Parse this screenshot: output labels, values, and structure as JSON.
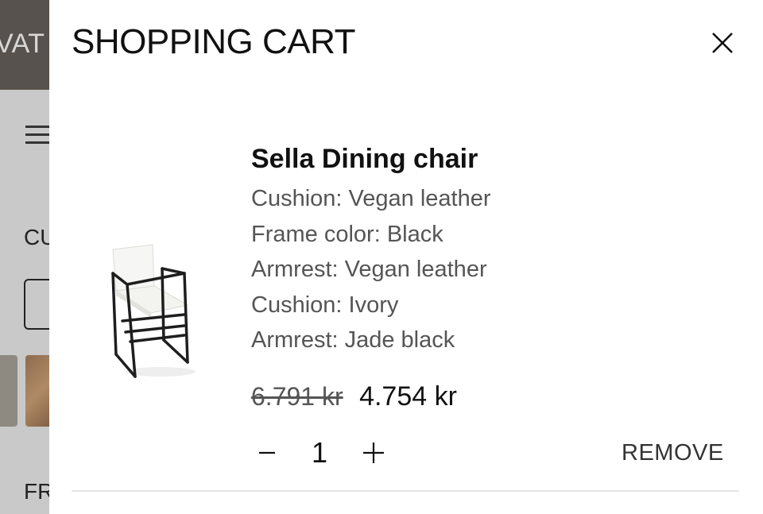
{
  "background_page": {
    "topbar_text": "VAT &",
    "heading_1": "CU",
    "heading_2": "FR"
  },
  "drawer": {
    "title": "SHOPPING CART",
    "close_icon": "close-icon"
  },
  "cart_items": [
    {
      "name": "Sella Dining chair",
      "options": [
        "Cushion: Vegan leather",
        "Frame color: Black",
        "Armrest: Vegan leather",
        "Cushion: Ivory",
        "Armrest: Jade black"
      ],
      "price_old": "6.791 kr",
      "price_new": "4.754 kr",
      "quantity": "1",
      "remove_label": "REMOVE",
      "image_icon": "chair-image"
    }
  ],
  "colors": {
    "topbar": "#57524d",
    "overlay_page": "#c9c9c9",
    "drawer": "#ffffff",
    "text": "#111111"
  }
}
